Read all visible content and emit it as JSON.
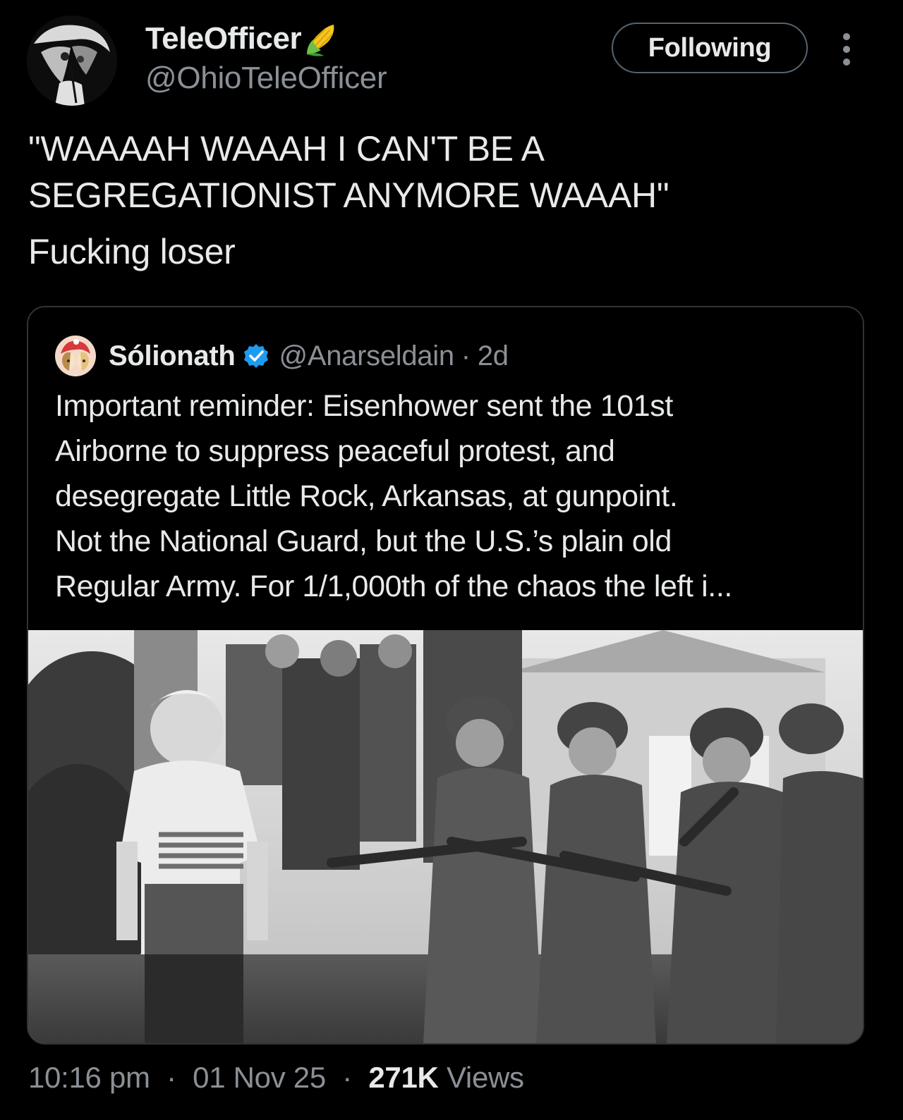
{
  "author": {
    "display_name": "TeleOfficer",
    "name_emoji_icon": "corn-icon",
    "handle": "@OhioTeleOfficer",
    "follow_label": "Following",
    "more_icon": "more-vertical-icon"
  },
  "tweet": {
    "lines": [
      "\"WAAAAH WAAAH I CAN'T BE A",
      "SEGREGATIONIST ANYMORE WAAAH\"",
      "Fucking loser"
    ]
  },
  "quote": {
    "display_name": "Sólionath",
    "verified_icon": "verified-badge-icon",
    "handle": "@Anarseldain",
    "separator": "·",
    "time": "2d",
    "lines": [
      "Important reminder: Eisenhower sent the 101st",
      "Airborne to suppress peaceful protest, and",
      "desegregate Little Rock, Arkansas, at gunpoint.",
      "Not the National Guard, but the U.S.’s plain old",
      "Regular Army. For 1/1,000th of the chaos the left i..."
    ],
    "photo_icon": "photo-image"
  },
  "meta": {
    "time": "10:16 pm",
    "separator": "·",
    "date": "01 Nov 25",
    "views_count": "271K",
    "views_label": "Views"
  },
  "colors": {
    "background": "#000000",
    "text_primary": "#e7e9ea",
    "text_secondary": "#8b9096",
    "border": "#2f3336",
    "verified_blue": "#1d9bf0"
  }
}
